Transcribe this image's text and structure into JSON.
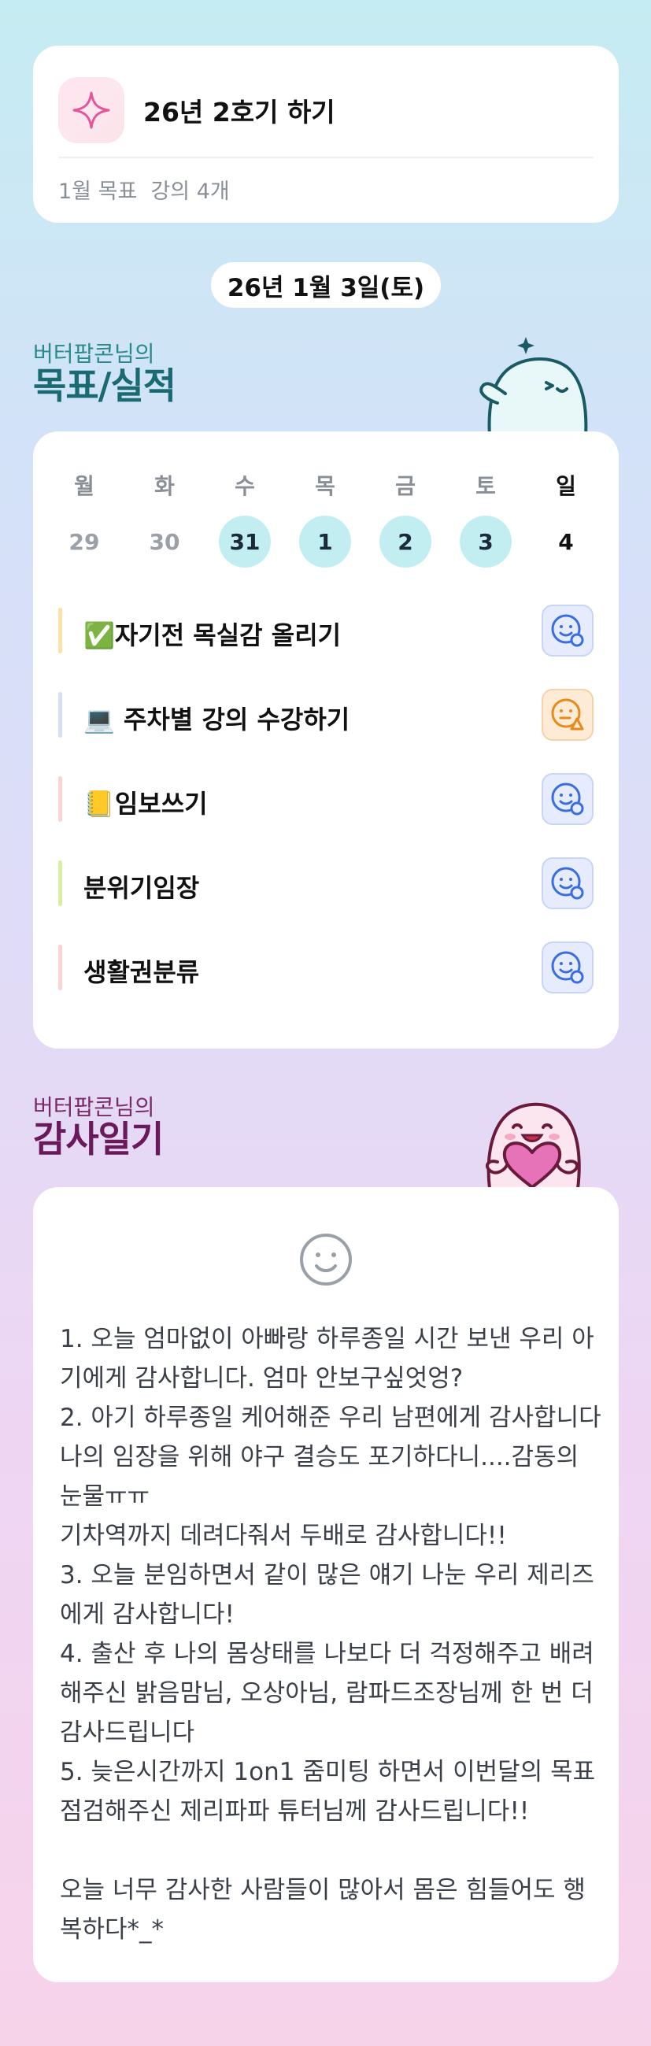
{
  "goal_card": {
    "title": "26년 2호기 하기",
    "subtitle": "1월 목표  강의 4개",
    "icon": "sparkle-icon"
  },
  "date_label": "26년 1월 3일(토)",
  "goals_section": {
    "owner": "버터팝콘님의",
    "title": "목표/실적"
  },
  "week": {
    "days": [
      "월",
      "화",
      "수",
      "목",
      "금",
      "토",
      "일"
    ],
    "dates": [
      "29",
      "30",
      "31",
      "1",
      "2",
      "3",
      "4"
    ],
    "active": [
      false,
      false,
      true,
      true,
      true,
      true,
      false
    ]
  },
  "goals": [
    {
      "emoji": "✅",
      "label": "자기전 목실감 올리기",
      "bar_color": "#fde2a8",
      "status": "blue",
      "status_icon": "smile-check-icon"
    },
    {
      "emoji": "💻",
      "label": "주차별 강의 수강하기",
      "bar_color": "#d5ddf7",
      "status": "orange",
      "status_icon": "meh-warning-icon"
    },
    {
      "emoji": "📒",
      "label": "임보쓰기",
      "bar_color": "#fbd3d3",
      "status": "blue",
      "status_icon": "smile-check-icon"
    },
    {
      "emoji": "",
      "label": "분위기임장",
      "bar_color": "#d7ef9f",
      "status": "blue",
      "status_icon": "smile-check-icon"
    },
    {
      "emoji": "",
      "label": "생활권분류",
      "bar_color": "#fbd3d3",
      "status": "blue",
      "status_icon": "smile-check-icon"
    }
  ],
  "gratitude_section": {
    "owner": "버터팝콘님의",
    "title": "감사일기"
  },
  "diary": {
    "mood_icon": "smile-face-icon",
    "text": "1. 오늘 엄마없이 아빠랑 하루종일 시간 보낸 우리 아기에게 감사합니다. 엄마 안보구싶엇엉?\n2. 아기 하루종일 케어해준 우리 남편에게 감사합니다 나의 임장을 위해 야구 결승도 포기하다니....감동의 눈물ㅠㅠ\n기차역까지 데려다줘서 두배로 감사합니다!!\n3. 오늘 분임하면서 같이 많은 얘기 나눈 우리 제리즈에게 감사합니다!\n4. 출산 후 나의 몸상태를 나보다 더 걱정해주고 배려해주신 밝음맘님, 오상아님, 람파드조장님께 한 번 더 감사드립니다\n5. 늦은시간까지 1on1 줌미팅 하면서 이번달의 목표 점검해주신 제리파파 튜터님께 감사드립니다!!\n\n오늘 너무 감사한 사람들이 많아서 몸은 힘들어도 행복하다*_*"
  },
  "colors": {
    "teal_title": "#1a6a72",
    "plum_title": "#6a1a5a",
    "active_day": "#c2eef2"
  }
}
